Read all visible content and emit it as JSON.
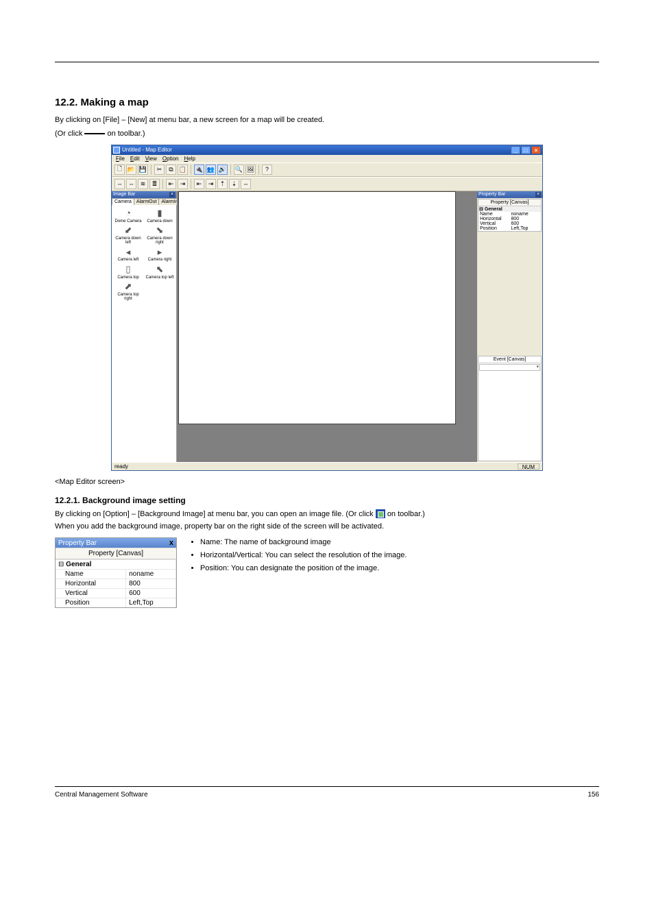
{
  "page": {
    "section_no": "12.2.",
    "section_title": "Making a map",
    "intro_1": "By clicking on [File] – [New] at menu bar, a new screen for a map will be created.",
    "intro_2": "(Or click",
    "intro_3": " on toolbar.)",
    "caption": "<Map Editor screen>",
    "subhead": "12.2.1. Background image setting",
    "body_1_a": "By clicking on [Option] – [Background Image] at menu bar, you can open an image file. (Or click ",
    "body_1_b": " on toolbar.)",
    "body_2": "When you add the background image, property bar on the right side of the screen will be activated.",
    "bullets": [
      "Name: The name of background image",
      "Horizontal/Vertical: You can select the resolution of the image.",
      "Position: You can designate the position of the image."
    ],
    "footer_left": "Central Management Software",
    "footer_right": "156"
  },
  "screenshot": {
    "title": "Untitled - Map Editor",
    "menus": [
      "File",
      "Edit",
      "View",
      "Option",
      "Help"
    ],
    "menu_underline_idx": [
      0,
      0,
      0,
      0,
      0
    ],
    "toolbar1": [
      "□",
      "▢",
      "▣",
      "|",
      "✂",
      "⧉",
      "⧉",
      "|",
      "🔌",
      "👥",
      "🔊",
      "|",
      "🔍",
      "🖼",
      "|",
      "?"
    ],
    "toolbar2": [
      "⇔",
      "⇔",
      "≋",
      "≣",
      "|",
      "⇤",
      "⇥",
      "|",
      "⇤",
      "⇥",
      "⇡",
      "⇣",
      "⇔"
    ],
    "imagebar": {
      "title": "Image Bar",
      "tabs": [
        "Camera",
        "AlarmOut",
        "AlarmIn"
      ],
      "items": [
        {
          "label": "Dome Camera",
          "glyph": "◔"
        },
        {
          "label": "Camera down",
          "glyph": "▮"
        },
        {
          "label": "Camera down left",
          "glyph": "⬋"
        },
        {
          "label": "Camera down right",
          "glyph": "⬊"
        },
        {
          "label": "Camera left",
          "glyph": "◂"
        },
        {
          "label": "Camera right",
          "glyph": "▸"
        },
        {
          "label": "Camera top",
          "glyph": "▯"
        },
        {
          "label": "Camera top left",
          "glyph": "⬉"
        },
        {
          "label": "Camera top right",
          "glyph": "⬈"
        }
      ]
    },
    "propertybar": {
      "title": "Property Bar",
      "heading": "Property [Canvas]",
      "group": "General",
      "rows": [
        {
          "k": "Name",
          "v": "noname"
        },
        {
          "k": "Horizontal",
          "v": "800"
        },
        {
          "k": "Vertical",
          "v": "600"
        },
        {
          "k": "Position",
          "v": "Left,Top"
        }
      ]
    },
    "eventbar": {
      "heading": "Event [Canvas]"
    },
    "status_left": "ready",
    "status_right": "NUM"
  },
  "propfig": {
    "title": "Property Bar",
    "heading": "Property [Canvas]",
    "group": "General",
    "rows": [
      {
        "k": "Name",
        "v": "noname"
      },
      {
        "k": "Horizontal",
        "v": "800"
      },
      {
        "k": "Vertical",
        "v": "600"
      },
      {
        "k": "Position",
        "v": "Left,Top"
      }
    ]
  }
}
